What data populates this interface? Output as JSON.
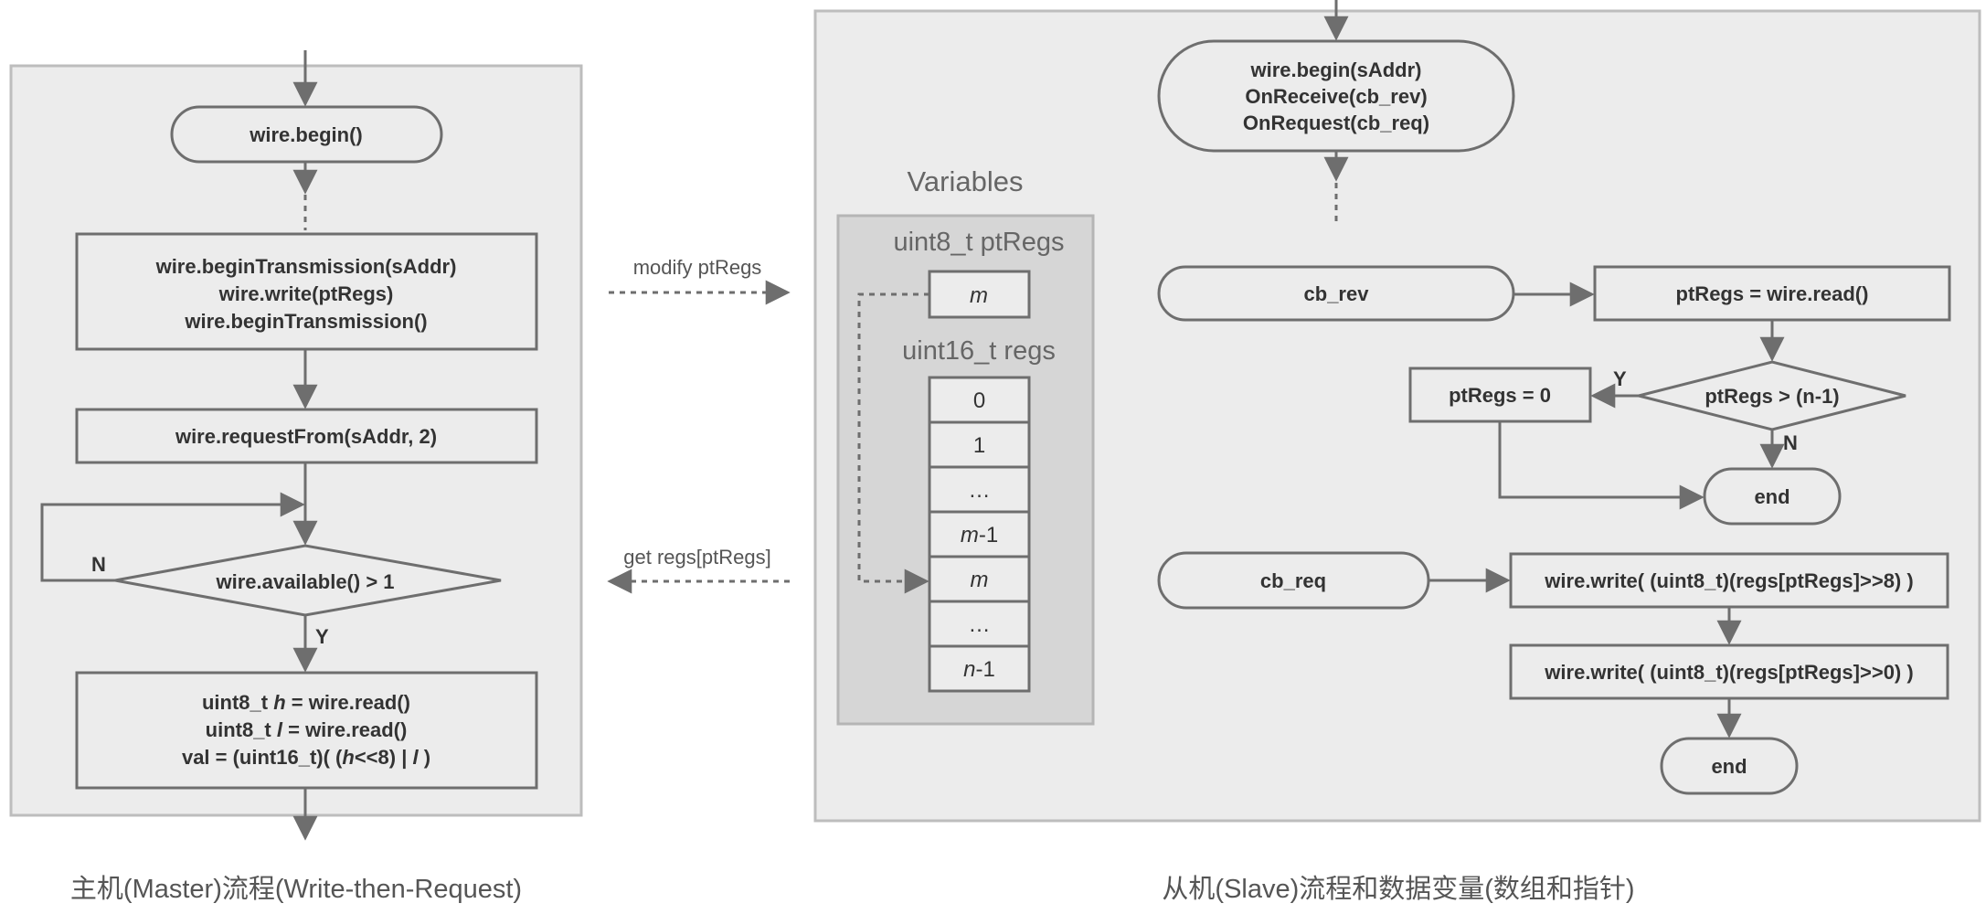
{
  "master": {
    "caption": "主机(Master)流程(Write-then-Request)",
    "begin": "wire.begin()",
    "transmission": [
      "wire.beginTransmission(sAddr)",
      "wire.write(ptRegs)",
      "wire.beginTransmission()"
    ],
    "request": "wire.requestFrom(sAddr, 2)",
    "available": "wire.available() > 1",
    "label_n": "N",
    "label_y": "Y",
    "read_lines": {
      "line1_prefix": "uint8_t  ",
      "line1_var": "h",
      "line1_suffix": " = wire.read()",
      "line2_prefix": "uint8_t  ",
      "line2_var": "l",
      "line2_suffix": " = wire.read()",
      "line3_prefix": "val = (uint16_t)( (",
      "line3_var1": "h",
      "line3_mid": "<<8) | ",
      "line3_var2": "l",
      "line3_suffix": " )"
    }
  },
  "links": {
    "modify": "modify  ptRegs",
    "get": "get  regs[ptRegs]"
  },
  "variables": {
    "title": "Variables",
    "ptregs_type": "uint8_t  ptRegs",
    "ptregs_value": "m",
    "regs_type": "uint16_t  regs",
    "regs_cells": [
      {
        "italic": "",
        "plain": "0"
      },
      {
        "italic": "",
        "plain": "1"
      },
      {
        "italic": "",
        "plain": "…"
      },
      {
        "italic": "m",
        "plain": "-1"
      },
      {
        "italic": "m",
        "plain": ""
      },
      {
        "italic": "",
        "plain": "…"
      },
      {
        "italic": "n",
        "plain": "-1"
      }
    ]
  },
  "slave": {
    "caption": "从机(Slave)流程和数据变量(数组和指针)",
    "begin": [
      "wire.begin(sAddr)",
      "OnReceive(cb_rev)",
      "OnRequest(cb_req)"
    ],
    "cb_rev": "cb_rev",
    "read_ptr": "ptRegs = wire.read()",
    "check": "ptRegs > (n-1)",
    "reset": "ptRegs = 0",
    "label_y": "Y",
    "label_n": "N",
    "end1": "end",
    "cb_req": "cb_req",
    "write_hi": "wire.write( (uint8_t)(regs[ptRegs]>>8) )",
    "write_lo": "wire.write( (uint8_t)(regs[ptRegs]>>0) )",
    "end2": "end"
  },
  "colors": {
    "stroke": "#6e6e6e",
    "panel_fill": "#ececec",
    "panel_border": "#bdbdbd",
    "var_fill": "#d6d6d6",
    "node_fill": "#ececec",
    "text": "#333333"
  }
}
